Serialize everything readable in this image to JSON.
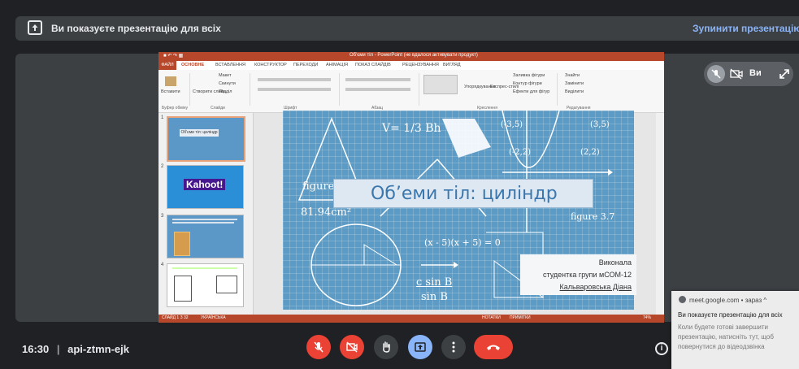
{
  "banner": {
    "message": "Ви показуєте презентацію для всіх",
    "stop_label": "Зупинити презентацію"
  },
  "ppt": {
    "window_title": "Об'єми тіл - PowerPoint (не вдалося активувати продукт)",
    "tabs": [
      "ФАЙЛ",
      "ОСНОВНЕ",
      "ВСТАВЛЕННЯ",
      "КОНСТРУКТОР",
      "ПЕРЕХОДИ",
      "АНІМАЦІЯ",
      "ПОКАЗ СЛАЙДІВ",
      "РЕЦЕНЗУВАННЯ",
      "ВИГЛЯД"
    ],
    "ribbon_groups": [
      "Буфер обміну",
      "Слайди",
      "Шрифт",
      "Абзац",
      "Креслення",
      "Редагування"
    ],
    "ribbon_buttons": {
      "paste": "Вставити",
      "new_slide": "Створити слайд",
      "layout": "Макет",
      "reset": "Скинути",
      "section": "Розділ",
      "arrange": "Упорядкування",
      "quick_styles": "Експрес-стилі",
      "shape_fill": "Заливка фігури",
      "shape_outline": "Контур фігури",
      "shape_effects": "Ефекти для фігур",
      "find": "Знайти",
      "replace": "Замінити",
      "select": "Виділити"
    },
    "thumbnails": [
      {
        "num": "1",
        "label": "Об'єми тіл: циліндр"
      },
      {
        "num": "2",
        "label": "Kahoot!"
      },
      {
        "num": "3",
        "label": ""
      },
      {
        "num": "4",
        "label": ""
      }
    ],
    "slide": {
      "title": "Об’еми тіл: циліндр",
      "author_lines": [
        "Виконала",
        "студентка групи мСОМ-12",
        "Кальваровська Діана"
      ],
      "math": {
        "formula_v": "V= 1/3 Bh",
        "neg35": "(-3,5)",
        "pos35": "(3,5)",
        "neg22": "(-2,2)",
        "pos22": "(2,2)",
        "figure": "figure",
        "area": "81.94cm²",
        "figure37": "figure 3.7",
        "product": "(x - 5)(x + 5) = 0",
        "csin_top": "c sin B",
        "csin_bot": "sin B"
      }
    },
    "status": {
      "slide_info": "СЛАЙД 1 З 32",
      "language": "УКРАЇНСЬКА",
      "notes": "НОТАТКИ",
      "comments": "ПРИМІТКИ",
      "zoom": "74%"
    }
  },
  "tile_controls": {
    "name": "Ви"
  },
  "notification": {
    "source": "meet.google.com • зараз ^",
    "title": "Ви показуєте презентацію для всіх",
    "body": "Коли будете готові завершити презентацію, натисніть тут, щоб повернутися до відеодзвінка"
  },
  "meeting": {
    "time": "16:30",
    "separator": "|",
    "code": "api-ztmn-ejk"
  },
  "colors": {
    "background": "#202124",
    "tile": "#3c4043",
    "accent_blue": "#8ab4f8",
    "danger_red": "#ea4335",
    "ppt_orange": "#b7472a",
    "slide_blue": "#5b9bc5"
  }
}
